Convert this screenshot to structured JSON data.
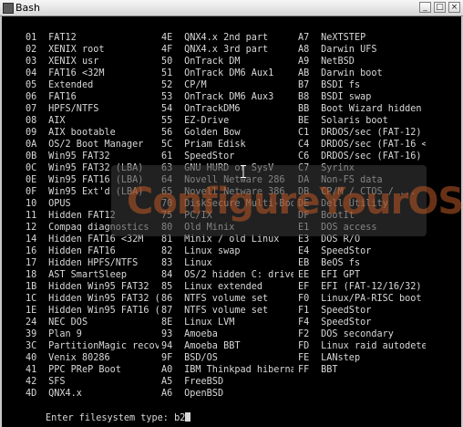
{
  "window": {
    "title": "Bash",
    "buttons": {
      "minimize": "_",
      "maximize": "□",
      "close": "×"
    }
  },
  "columns": [
    [
      {
        "code": "01",
        "name": "FAT12"
      },
      {
        "code": "02",
        "name": "XENIX root"
      },
      {
        "code": "03",
        "name": "XENIX usr"
      },
      {
        "code": "04",
        "name": "FAT16 <32M"
      },
      {
        "code": "05",
        "name": "Extended"
      },
      {
        "code": "06",
        "name": "FAT16"
      },
      {
        "code": "07",
        "name": "HPFS/NTFS"
      },
      {
        "code": "08",
        "name": "AIX"
      },
      {
        "code": "09",
        "name": "AIX bootable"
      },
      {
        "code": "0A",
        "name": "OS/2 Boot Manager"
      },
      {
        "code": "0B",
        "name": "Win95 FAT32"
      },
      {
        "code": "0C",
        "name": "Win95 FAT32 (LBA)"
      },
      {
        "code": "0E",
        "name": "Win95 FAT16 (LBA)"
      },
      {
        "code": "0F",
        "name": "Win95 Ext'd (LBA)"
      },
      {
        "code": "10",
        "name": "OPUS"
      },
      {
        "code": "11",
        "name": "Hidden FAT12"
      },
      {
        "code": "12",
        "name": "Compaq diagnostics"
      },
      {
        "code": "14",
        "name": "Hidden FAT16 <32M"
      },
      {
        "code": "16",
        "name": "Hidden FAT16"
      },
      {
        "code": "17",
        "name": "Hidden HPFS/NTFS"
      },
      {
        "code": "18",
        "name": "AST SmartSleep"
      },
      {
        "code": "1B",
        "name": "Hidden Win95 FAT32"
      },
      {
        "code": "1C",
        "name": "Hidden Win95 FAT32 ("
      },
      {
        "code": "1E",
        "name": "Hidden Win95 FAT16 ("
      },
      {
        "code": "24",
        "name": "NEC DOS"
      },
      {
        "code": "39",
        "name": "Plan 9"
      },
      {
        "code": "3C",
        "name": "PartitionMagic recov"
      },
      {
        "code": "40",
        "name": "Venix 80286"
      },
      {
        "code": "41",
        "name": "PPC PReP Boot"
      },
      {
        "code": "42",
        "name": "SFS"
      },
      {
        "code": "4D",
        "name": "QNX4.x"
      }
    ],
    [
      {
        "code": "4E",
        "name": "QNX4.x 2nd part"
      },
      {
        "code": "4F",
        "name": "QNX4.x 3rd part"
      },
      {
        "code": "50",
        "name": "OnTrack DM"
      },
      {
        "code": "51",
        "name": "OnTrack DM6 Aux1"
      },
      {
        "code": "52",
        "name": "CP/M"
      },
      {
        "code": "53",
        "name": "OnTrack DM6 Aux3"
      },
      {
        "code": "54",
        "name": "OnTrackDM6"
      },
      {
        "code": "55",
        "name": "EZ-Drive"
      },
      {
        "code": "56",
        "name": "Golden Bow"
      },
      {
        "code": "5C",
        "name": "Priam Edisk"
      },
      {
        "code": "61",
        "name": "SpeedStor"
      },
      {
        "code": "63",
        "name": "GNU HURD or SysV"
      },
      {
        "code": "64",
        "name": "Novell Netware 286"
      },
      {
        "code": "65",
        "name": "Novell Netware 386"
      },
      {
        "code": "70",
        "name": "DiskSecure Multi-Boo"
      },
      {
        "code": "75",
        "name": "PC/IX"
      },
      {
        "code": "80",
        "name": "Old Minix"
      },
      {
        "code": "81",
        "name": "Minix / old Linux"
      },
      {
        "code": "82",
        "name": "Linux swap"
      },
      {
        "code": "83",
        "name": "Linux"
      },
      {
        "code": "84",
        "name": "OS/2 hidden C: drive"
      },
      {
        "code": "85",
        "name": "Linux extended"
      },
      {
        "code": "86",
        "name": "NTFS volume set"
      },
      {
        "code": "87",
        "name": "NTFS volume set"
      },
      {
        "code": "8E",
        "name": "Linux LVM"
      },
      {
        "code": "93",
        "name": "Amoeba"
      },
      {
        "code": "94",
        "name": "Amoeba BBT"
      },
      {
        "code": "9F",
        "name": "BSD/OS"
      },
      {
        "code": "A0",
        "name": "IBM Thinkpad hiberna"
      },
      {
        "code": "A5",
        "name": "FreeBSD"
      },
      {
        "code": "A6",
        "name": "OpenBSD"
      }
    ],
    [
      {
        "code": "A7",
        "name": "NeXTSTEP"
      },
      {
        "code": "A8",
        "name": "Darwin UFS"
      },
      {
        "code": "A9",
        "name": "NetBSD"
      },
      {
        "code": "AB",
        "name": "Darwin boot"
      },
      {
        "code": "B7",
        "name": "BSDI fs"
      },
      {
        "code": "B8",
        "name": "BSDI swap"
      },
      {
        "code": "BB",
        "name": "Boot Wizard hidden"
      },
      {
        "code": "BE",
        "name": "Solaris boot"
      },
      {
        "code": "C1",
        "name": "DRDOS/sec (FAT-12)"
      },
      {
        "code": "C4",
        "name": "DRDOS/sec (FAT-16 <"
      },
      {
        "code": "C6",
        "name": "DRDOS/sec (FAT-16)"
      },
      {
        "code": "C7",
        "name": "Syrinx"
      },
      {
        "code": "DA",
        "name": "Non-FS data"
      },
      {
        "code": "DB",
        "name": "CP/M / CTOS / ..."
      },
      {
        "code": "DE",
        "name": "Dell Utility"
      },
      {
        "code": "DF",
        "name": "BootIt"
      },
      {
        "code": "E1",
        "name": "DOS access"
      },
      {
        "code": "E3",
        "name": "DOS R/O"
      },
      {
        "code": "E4",
        "name": "SpeedStor"
      },
      {
        "code": "EB",
        "name": "BeOS fs"
      },
      {
        "code": "EE",
        "name": "EFI GPT"
      },
      {
        "code": "EF",
        "name": "EFI (FAT-12/16/32)"
      },
      {
        "code": "F0",
        "name": "Linux/PA-RISC boot"
      },
      {
        "code": "F1",
        "name": "SpeedStor"
      },
      {
        "code": "F4",
        "name": "SpeedStor"
      },
      {
        "code": "F2",
        "name": "DOS secondary"
      },
      {
        "code": "FD",
        "name": "Linux raid autodetec"
      },
      {
        "code": "FE",
        "name": "LANstep"
      },
      {
        "code": "FF",
        "name": "BBT"
      }
    ]
  ],
  "prompt": {
    "label": "Enter filesystem type: ",
    "value": "b2"
  },
  "watermark": {
    "text": "ConfigureYourOS"
  },
  "colors": {
    "terminal_bg": "#000000",
    "terminal_fg": "#d8d8d8",
    "watermark": "#be5a28"
  },
  "icons": {
    "title": "terminal-icon"
  }
}
